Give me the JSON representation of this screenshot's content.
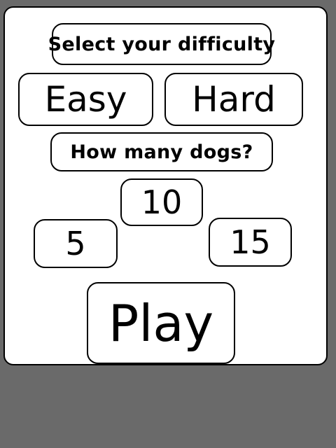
{
  "menu": {
    "difficulty_prompt": "Select your difficulty",
    "difficulty_options": {
      "easy": "Easy",
      "hard": "Hard"
    },
    "dogs_prompt": "How many dogs?",
    "dog_counts": {
      "ten": "10",
      "five": "5",
      "fifteen": "15"
    },
    "play_label": "Play"
  },
  "colors": {
    "background": "#6a6a6a",
    "panel": "#ffffff",
    "border": "#000000",
    "text": "#000000"
  }
}
